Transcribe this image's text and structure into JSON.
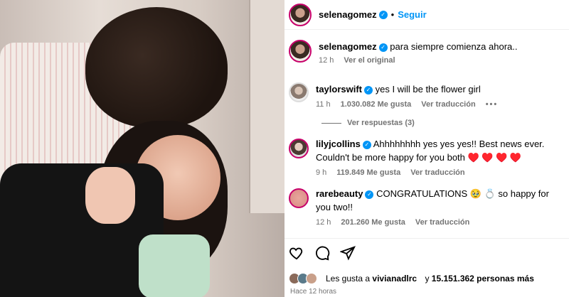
{
  "post_author": {
    "username": "selenagomez",
    "follow_label": "Seguir",
    "dot": "•"
  },
  "caption": {
    "username": "selenagomez",
    "text": "para siempre comienza ahora..",
    "time": "12 h",
    "action": "Ver el original"
  },
  "comments": [
    {
      "username": "taylorswift",
      "text": "yes I will be the flower girl",
      "time": "11 h",
      "likes": "1.030.082 Me gusta",
      "translate": "Ver traducción",
      "more": "•••",
      "replies": "Ver respuestas (3)"
    },
    {
      "username": "lilyjcollins",
      "text": "Ahhhhhhhh yes yes yes!! Best news ever. Couldn't be more happy for you both ♥️ ♥️ ♥️ ♥️",
      "time": "9 h",
      "likes": "119.849 Me gusta",
      "translate": "Ver traducción"
    },
    {
      "username": "rarebeauty",
      "text": "CONGRATULATIONS 🥹 💍 so happy for you two!!",
      "time": "12 h",
      "likes": "201.260 Me gusta",
      "translate": "Ver traducción"
    }
  ],
  "likes_summary": {
    "prefix": "Les gusta a",
    "user": "vivianadlrc",
    "joiner": "y",
    "rest": "15.151.362 personas más"
  },
  "posted": "Hace 12 horas",
  "icons": {
    "like": "heart-icon",
    "comment": "comment-icon",
    "share": "share-icon",
    "verified": "verified-badge-icon"
  },
  "colors": {
    "link": "#0095f6",
    "meta": "#737373",
    "verified": "#0095f6"
  }
}
